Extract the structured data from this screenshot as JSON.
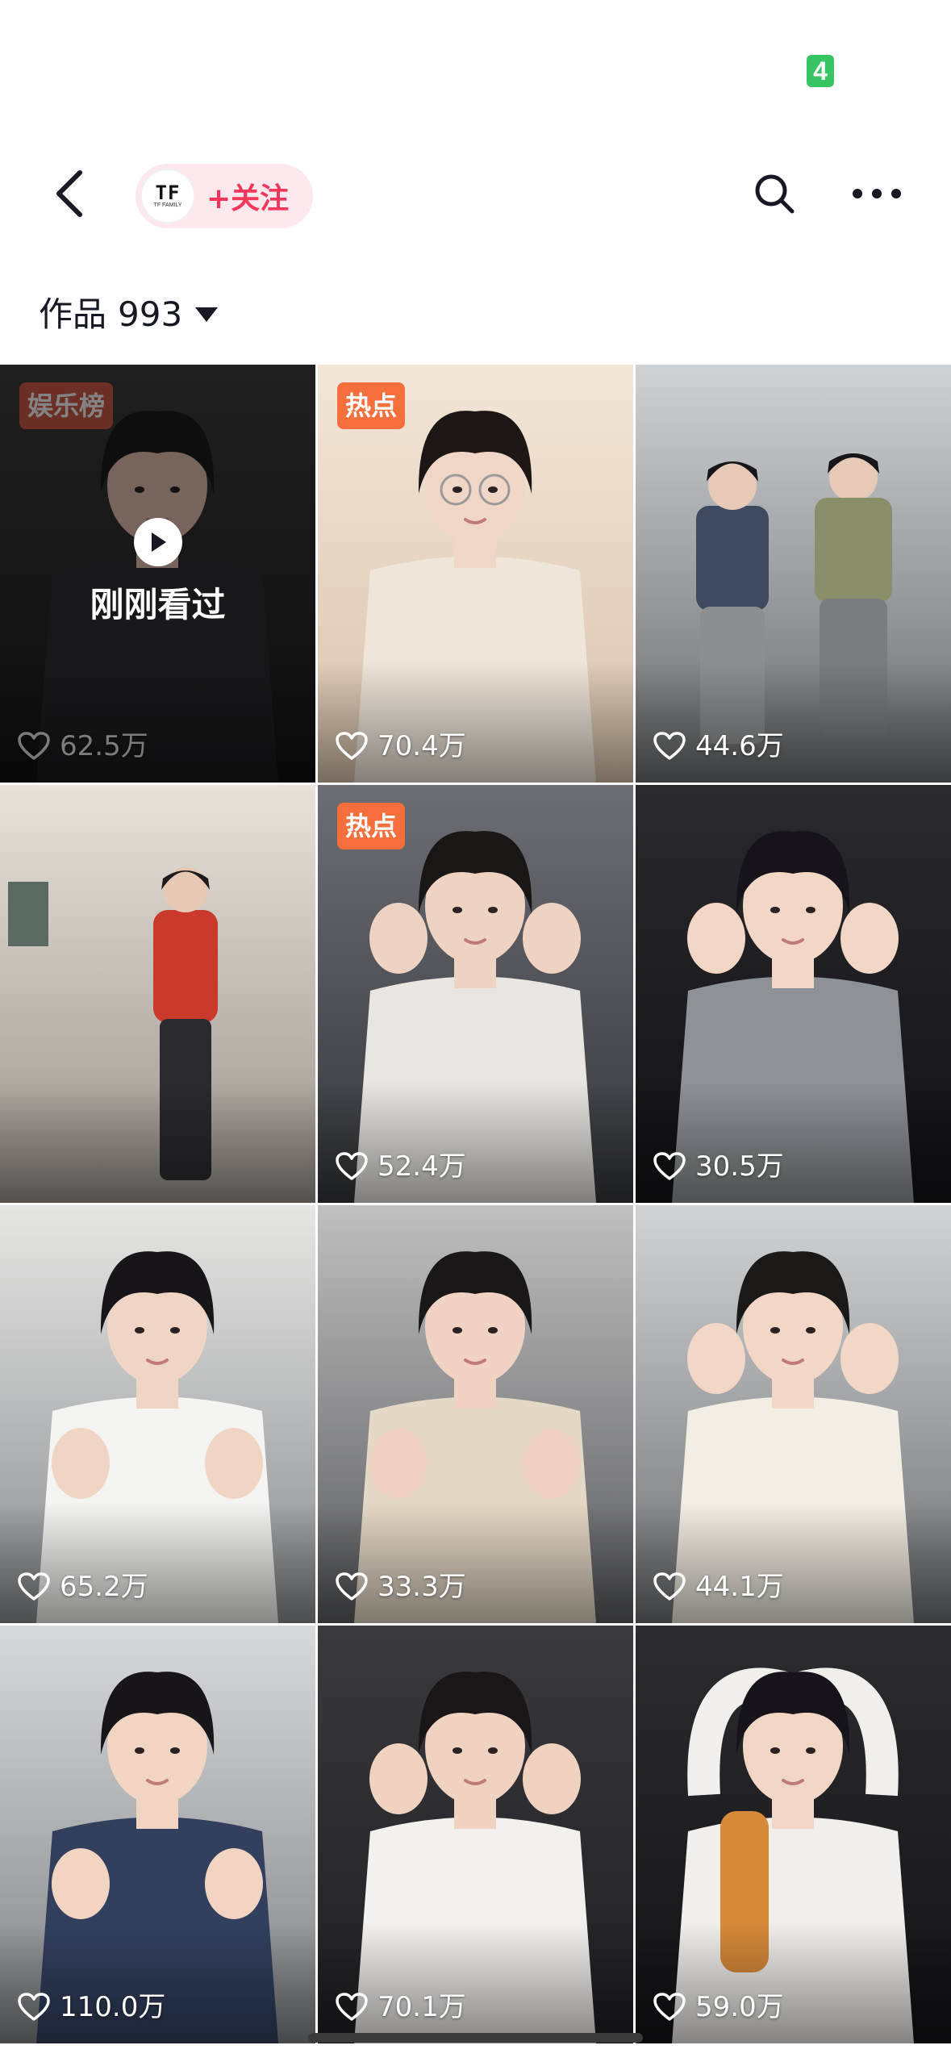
{
  "status_bar": {
    "battery_level": "4",
    "battery_color": "#39c463"
  },
  "header": {
    "back_icon": "chevron-left-icon",
    "account": {
      "logo_text": "TF",
      "logo_subtext": "TF FAMILY"
    },
    "follow_label": "+关注",
    "follow_color": "#f2375a",
    "search_icon": "search-icon",
    "more_icon": "more-dots-icon"
  },
  "works_bar": {
    "label": "作品",
    "count": "993"
  },
  "grid": {
    "videos": [
      {
        "likes": "62.5万",
        "tag": "娱乐榜",
        "tag_color": "#c9452e",
        "recently_viewed": true,
        "recent_label": "刚刚看过",
        "thumb": "hoodie-dark"
      },
      {
        "likes": "70.4万",
        "tag": "热点",
        "tag_color": "#f56f3c",
        "recently_viewed": false,
        "thumb": "glasses-cream"
      },
      {
        "likes": "44.6万",
        "tag": null,
        "recently_viewed": false,
        "thumb": "dance-studio"
      },
      {
        "likes": "",
        "tag": null,
        "recently_viewed": false,
        "thumb": "corridor-red-jacket"
      },
      {
        "likes": "52.4万",
        "tag": "热点",
        "tag_color": "#f56f3c",
        "recently_viewed": false,
        "thumb": "heart-hands-white-hoodie"
      },
      {
        "likes": "30.5万",
        "tag": null,
        "recently_viewed": false,
        "thumb": "heart-hands-grey-teal"
      },
      {
        "likes": "65.2万",
        "tag": null,
        "recently_viewed": false,
        "thumb": "heart-hands-white-cardigan"
      },
      {
        "likes": "33.3万",
        "tag": null,
        "recently_viewed": false,
        "thumb": "headband-knit-cardigan"
      },
      {
        "likes": "44.1万",
        "tag": null,
        "recently_viewed": false,
        "thumb": "hood-floral-cardigan"
      },
      {
        "likes": "110.0万",
        "tag": null,
        "recently_viewed": false,
        "thumb": "heart-hands-striped"
      },
      {
        "likes": "70.1万",
        "tag": null,
        "recently_viewed": false,
        "thumb": "fluffy-white-jacket"
      },
      {
        "likes": "59.0万",
        "tag": null,
        "recently_viewed": false,
        "thumb": "overhead-heart-scarf"
      }
    ]
  }
}
